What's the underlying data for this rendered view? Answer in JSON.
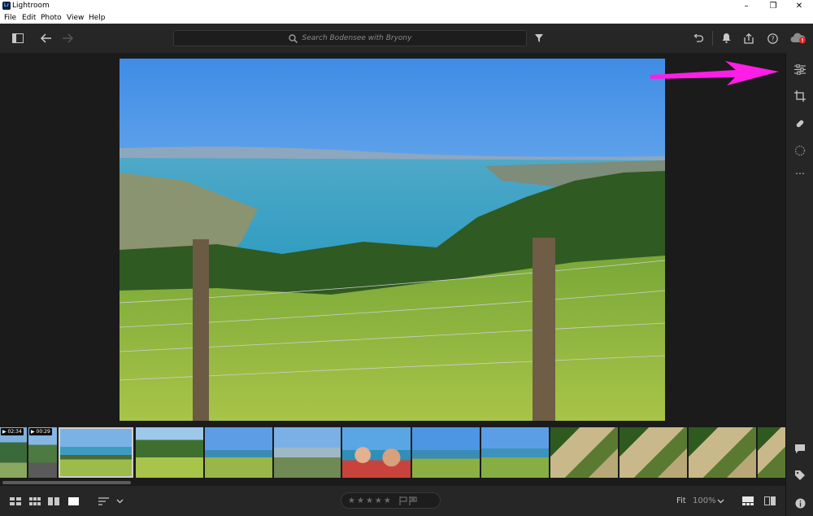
{
  "window": {
    "title": "Lightroom",
    "logo_text": "Lr",
    "minimize": "–",
    "maximize": "❐",
    "close": "✕"
  },
  "menu": [
    "File",
    "Edit",
    "Photo",
    "View",
    "Help"
  ],
  "toolbar": {
    "search_placeholder": "Search Bodensee with Bryony"
  },
  "filmstrip": {
    "durations": [
      "▶ 02:34",
      "▶ 00:29"
    ],
    "selected_index": 2
  },
  "bottom": {
    "stars": [
      "★",
      "★",
      "★",
      "★",
      "★"
    ],
    "fit_label": "Fit",
    "zoom_level": "100%"
  },
  "colors": {
    "accent_arrow": "#ff1ee6",
    "cloud_alert": "#e02424"
  }
}
